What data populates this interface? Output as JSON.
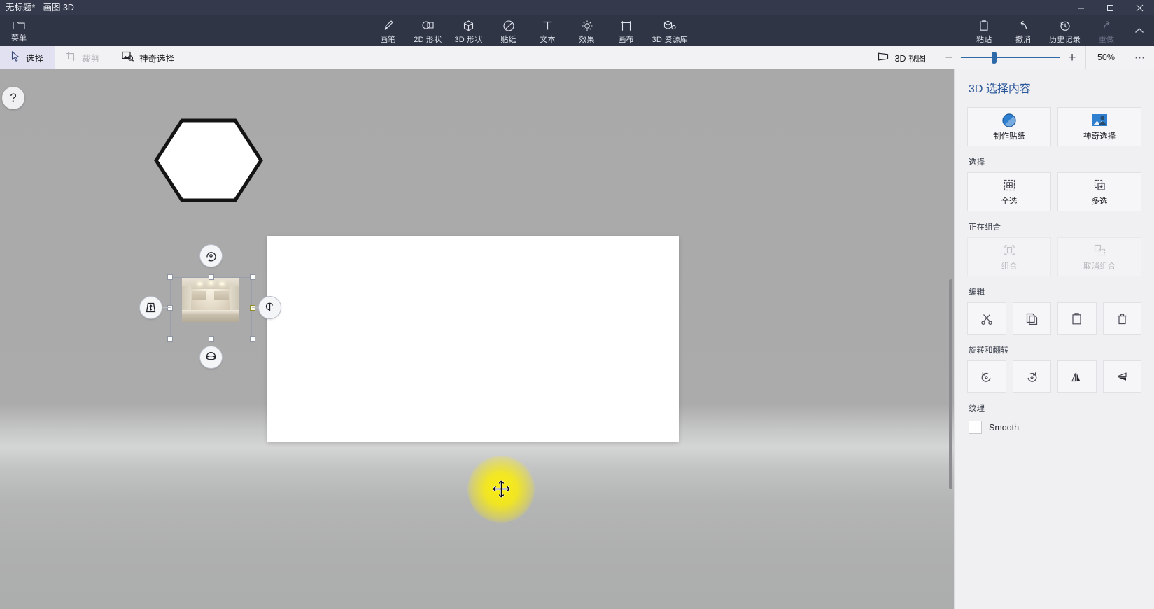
{
  "window": {
    "title": "无标题* - 画图 3D",
    "minimize": "—",
    "maximize": "❐",
    "close": "✕"
  },
  "ribbon": {
    "menu": {
      "label": "菜单",
      "icon": "folder-icon"
    },
    "tools": [
      {
        "label": "画笔",
        "icon": "brush-icon"
      },
      {
        "label": "2D 形状",
        "icon": "2d-shapes-icon"
      },
      {
        "label": "3D 形状",
        "icon": "3d-shapes-icon"
      },
      {
        "label": "贴纸",
        "icon": "sticker-icon"
      },
      {
        "label": "文本",
        "icon": "text-icon"
      },
      {
        "label": "效果",
        "icon": "effects-icon"
      },
      {
        "label": "画布",
        "icon": "canvas-icon"
      },
      {
        "label": "3D 资源库",
        "icon": "3d-library-icon"
      }
    ],
    "actions": [
      {
        "label": "粘贴",
        "icon": "paste-icon",
        "enabled": true
      },
      {
        "label": "撤消",
        "icon": "undo-icon",
        "enabled": true
      },
      {
        "label": "历史记录",
        "icon": "history-icon",
        "enabled": true
      },
      {
        "label": "重做",
        "icon": "redo-icon",
        "enabled": false
      }
    ],
    "collapse": "⌃"
  },
  "toolstrip": {
    "items": [
      {
        "label": "选择",
        "icon": "cursor-icon",
        "state": "active"
      },
      {
        "label": "裁剪",
        "icon": "crop-icon",
        "state": "disabled"
      },
      {
        "label": "神奇选择",
        "icon": "magic-select-icon",
        "state": "normal"
      }
    ],
    "view3d": {
      "label": "3D 视图",
      "icon": "view-3d-icon"
    },
    "zoom_out": "−",
    "zoom_in": "+",
    "zoom_percent": "50%",
    "more": "⋯"
  },
  "canvas": {
    "help": "?",
    "shapes": [
      {
        "name": "hexagon-outline",
        "stroke": "#141414"
      },
      {
        "name": "kitchen-photo-sticker"
      }
    ],
    "gizmos": [
      {
        "name": "rotate-z-gizmo",
        "position": "top"
      },
      {
        "name": "depth-move-gizmo",
        "position": "left"
      },
      {
        "name": "rotate-y-gizmo",
        "position": "right"
      },
      {
        "name": "rotate-x-gizmo",
        "position": "bottom"
      }
    ],
    "cursor": "move-cursor",
    "highlight_color": "#fff200"
  },
  "panel": {
    "title": "3D 选择内容",
    "top_tiles": [
      {
        "label": "制作贴纸",
        "icon": "make-sticker-icon",
        "enabled": true
      },
      {
        "label": "神奇选择",
        "icon": "magic-select-icon",
        "enabled": true
      }
    ],
    "select": {
      "label": "选择",
      "tiles": [
        {
          "label": "全选",
          "icon": "select-all-icon",
          "enabled": true
        },
        {
          "label": "多选",
          "icon": "multi-select-icon",
          "enabled": true
        }
      ]
    },
    "grouping": {
      "label": "正在组合",
      "tiles": [
        {
          "label": "组合",
          "icon": "group-icon",
          "enabled": false
        },
        {
          "label": "取消组合",
          "icon": "ungroup-icon",
          "enabled": false
        }
      ]
    },
    "edit": {
      "label": "编辑",
      "tiles": [
        {
          "label": "",
          "icon": "cut-icon",
          "enabled": true
        },
        {
          "label": "",
          "icon": "copy-icon",
          "enabled": true
        },
        {
          "label": "",
          "icon": "paste-icon",
          "enabled": true
        },
        {
          "label": "",
          "icon": "delete-icon",
          "enabled": true
        }
      ]
    },
    "rotate_flip": {
      "label": "旋转和翻转",
      "tiles": [
        {
          "label": "",
          "icon": "rotate-left-icon",
          "enabled": true
        },
        {
          "label": "",
          "icon": "rotate-right-icon",
          "enabled": true
        },
        {
          "label": "",
          "icon": "flip-horizontal-icon",
          "enabled": true
        },
        {
          "label": "",
          "icon": "flip-vertical-icon",
          "enabled": true
        }
      ]
    },
    "texture": {
      "label": "纹理",
      "checkbox_label": "Smooth",
      "checked": false
    }
  }
}
